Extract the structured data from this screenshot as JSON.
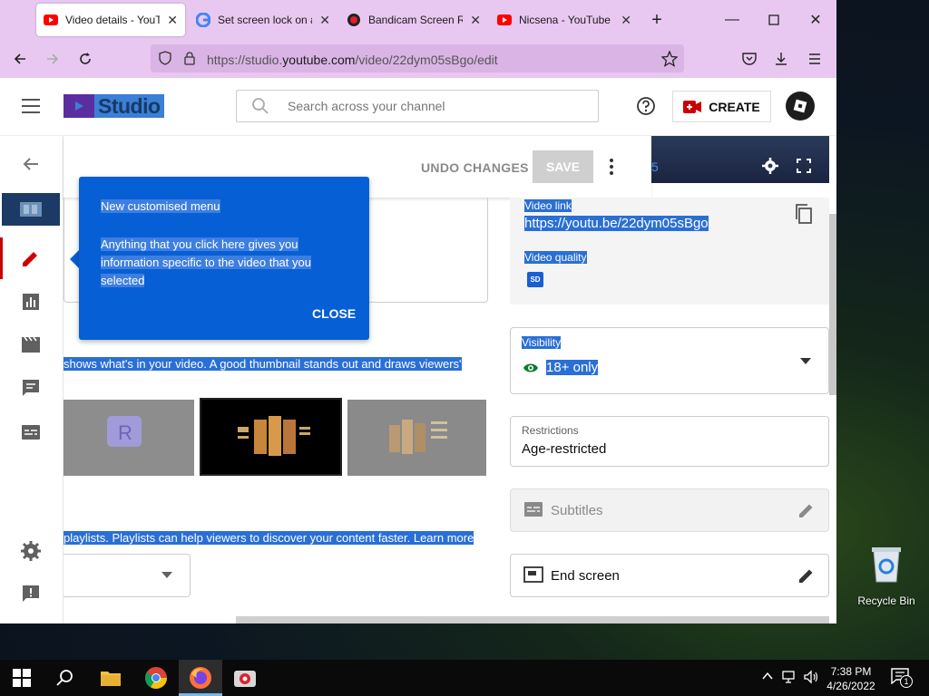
{
  "browser": {
    "tabs": [
      {
        "title": "Video details - YouTube",
        "icon": "youtube-icon"
      },
      {
        "title": "Set screen lock on an",
        "icon": "google-icon"
      },
      {
        "title": "Bandicam Screen Rec",
        "icon": "bandicam-icon"
      },
      {
        "title": "Nicsena - YouTube",
        "icon": "youtube-icon"
      }
    ],
    "url_prefix": "https://studio.",
    "url_domain": "youtube.com",
    "url_path": "/video/22dym05sBgo/edit"
  },
  "studio": {
    "logo_text": "Studio",
    "search_placeholder": "Search across your channel",
    "create_label": "CREATE"
  },
  "editor": {
    "undo_label": "UNDO CHANGES",
    "save_label": "SAVE",
    "thumbnail_text": "shows what's in your video. A good thumbnail stands out and draws viewers'",
    "playlist_text": "playlists. Playlists can help viewers to discover your content faster. Learn more"
  },
  "tooltip": {
    "title": "New customised menu",
    "body": "Anything that you click here gives you information specific to the video that you selected",
    "close_label": "CLOSE"
  },
  "details": {
    "preview_time": "5",
    "video_link_label": "Video link",
    "video_link": "https://youtu.be/22dym05sBgo",
    "video_quality_label": "Video quality",
    "quality_badge": "SD",
    "visibility_label": "Visibility",
    "visibility_value": "18+ only",
    "restrictions_label": "Restrictions",
    "restrictions_value": "Age-restricted",
    "subtitles_label": "Subtitles",
    "end_screen_label": "End screen"
  },
  "desktop": {
    "recycle_bin_label": "Recycle Bin"
  },
  "taskbar": {
    "time": "7:38 PM",
    "date": "4/26/2022",
    "notification_count": "1"
  },
  "colors": {
    "accent_blue": "#065fd4",
    "youtube_red": "#cc0000",
    "tab_bar": "#e8c8f0"
  }
}
